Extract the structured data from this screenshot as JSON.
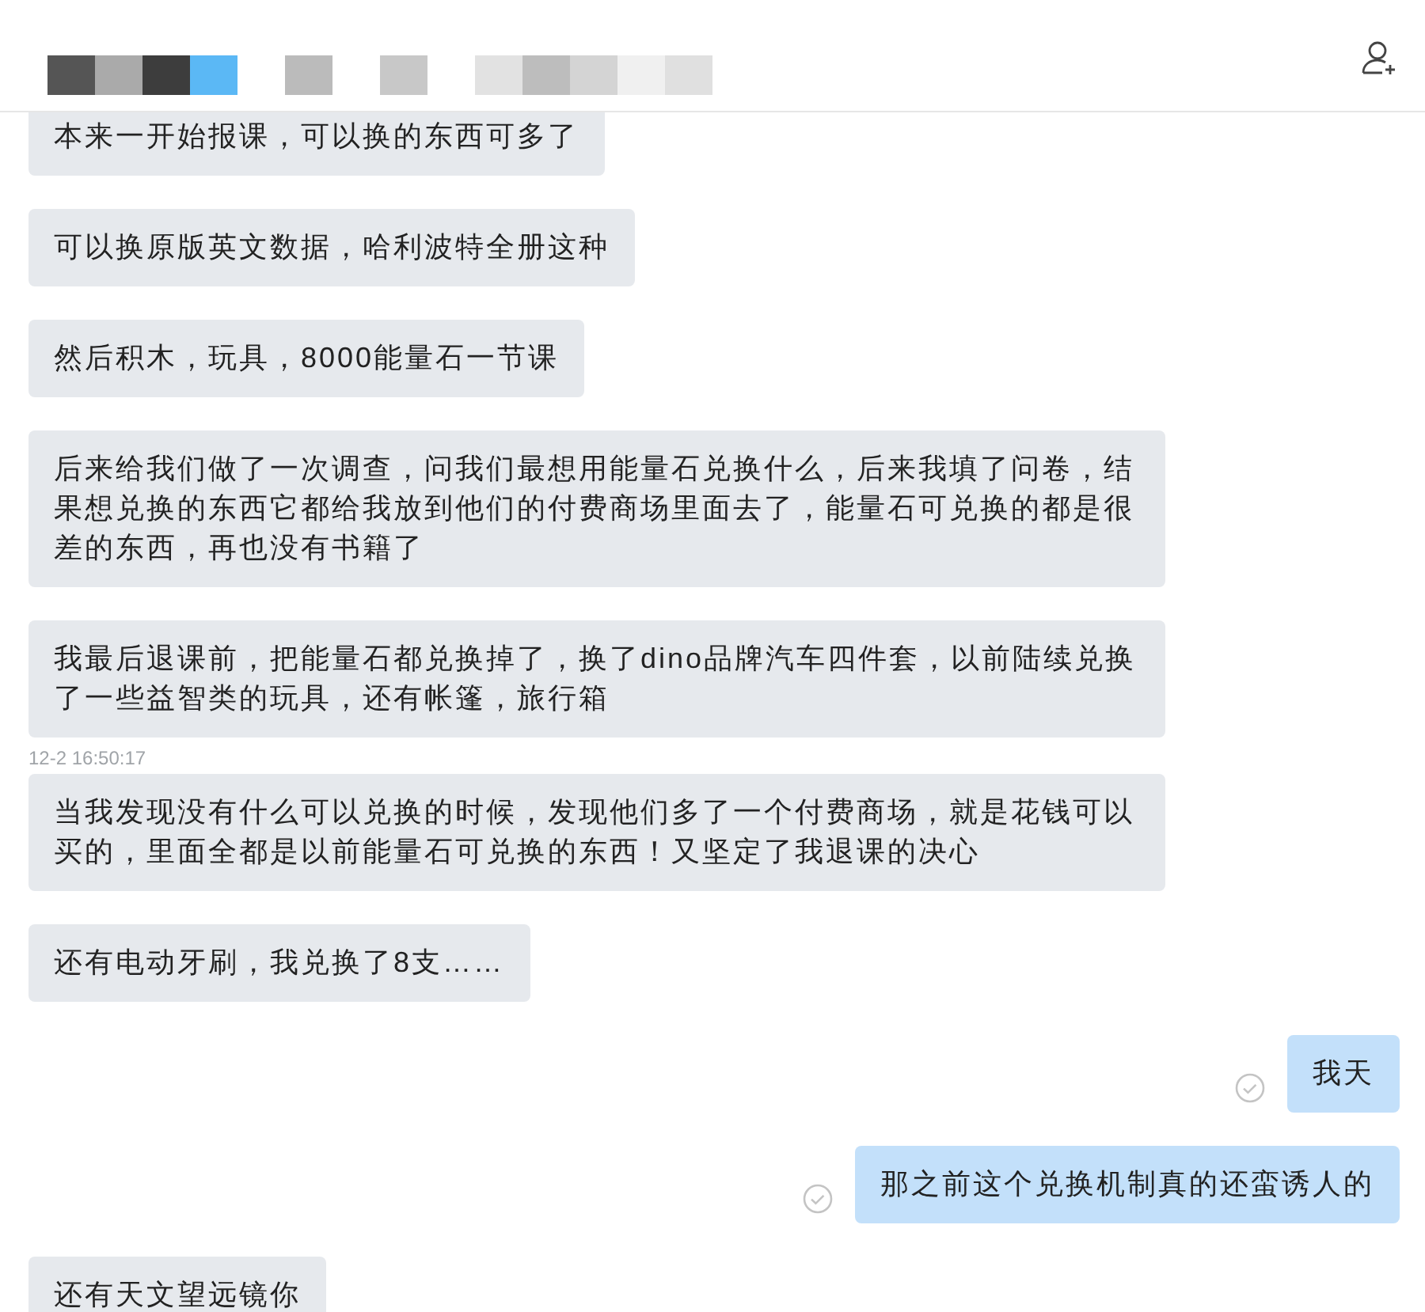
{
  "messages": [
    {
      "kind": "incoming",
      "text": "本来一开始报课，可以换的东西可多了"
    },
    {
      "kind": "incoming",
      "text": "可以换原版英文数据，哈利波特全册这种"
    },
    {
      "kind": "incoming",
      "text": "然后积木，玩具，8000能量石一节课"
    },
    {
      "kind": "incoming",
      "text": "后来给我们做了一次调查，问我们最想用能量石兑换什么，后来我填了问卷，结果想兑换的东西它都给我放到他们的付费商场里面去了，能量石可兑换的都是很差的东西，再也没有书籍了"
    },
    {
      "kind": "incoming",
      "text": "我最后退课前，把能量石都兑换掉了，换了dino品牌汽车四件套，以前陆续兑换了一些益智类的玩具，还有帐篷，旅行箱"
    },
    {
      "kind": "timestamp",
      "text": "12-2 16:50:17"
    },
    {
      "kind": "incoming",
      "text": "当我发现没有什么可以兑换的时候，发现他们多了一个付费商场，就是花钱可以买的，里面全都是以前能量石可兑换的东西！又坚定了我退课的决心"
    },
    {
      "kind": "incoming",
      "text": "还有电动牙刷，我兑换了8支……"
    },
    {
      "kind": "outgoing",
      "text": "我天"
    },
    {
      "kind": "outgoing",
      "text": "那之前这个兑换机制真的还蛮诱人的"
    },
    {
      "kind": "incoming",
      "text": "还有天文望远镜你"
    }
  ]
}
